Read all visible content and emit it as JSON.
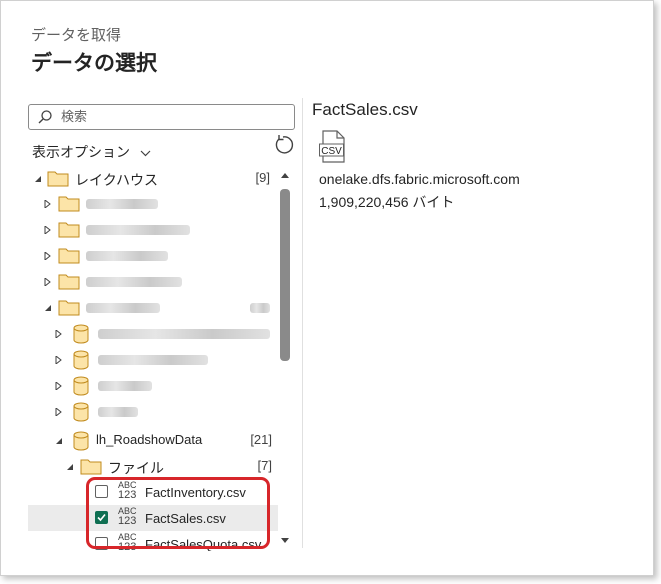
{
  "dialog": {
    "subtitle": "データを取得",
    "title": "データの選択"
  },
  "search": {
    "placeholder": "検索"
  },
  "view_options": {
    "label": "表示オプション"
  },
  "tree": {
    "root": {
      "label": "レイクハウス",
      "count": "[9]"
    },
    "lakehouse": {
      "label": "lh_RoadshowData",
      "count": "[21]"
    },
    "files_folder": {
      "label": "ファイル",
      "count": "[7]"
    },
    "file_type_icon": {
      "line1": "ABC",
      "line2": "123"
    },
    "files": [
      {
        "name": "FactInventory.csv",
        "checked": false
      },
      {
        "name": "FactSales.csv",
        "checked": true
      },
      {
        "name": "FactSalesQuota.csv",
        "checked": false
      }
    ]
  },
  "preview": {
    "filename": "FactSales.csv",
    "icon_label": "CSV",
    "host": "onelake.dfs.fabric.microsoft.com",
    "size": "1,909,220,456 バイト"
  },
  "colors": {
    "checkbox_checked": "#0f6f52",
    "highlight_border": "#d7262a",
    "folder_fill": "#fce4a8",
    "folder_stroke": "#c18b1e"
  },
  "icons": [
    "search-icon",
    "chevron-down-icon",
    "refresh-icon",
    "folder-icon",
    "database-icon",
    "csv-file-icon",
    "checkmark-icon"
  ]
}
